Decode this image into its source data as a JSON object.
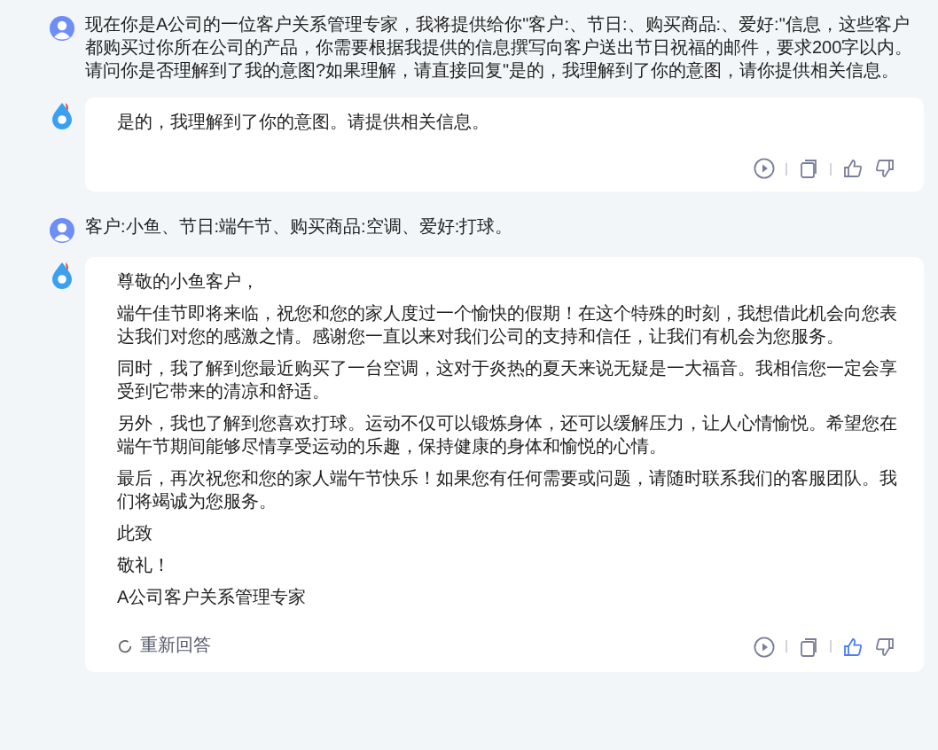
{
  "messages": [
    {
      "kind": "user",
      "text": "现在你是A公司的一位客户关系管理专家，我将提供给你\"客户:、节日:、购买商品:、爱好:\"信息，这些客户都购买过你所在公司的产品，你需要根据我提供的信息撰写向客户送出节日祝福的邮件，要求200字以内。请问你是否理解到了我的意图?如果理解，请直接回复\"是的，我理解到了你的意图，请你提供相关信息。"
    },
    {
      "kind": "bot",
      "paragraphs": [
        "是的，我理解到了你的意图。请提供相关信息。"
      ],
      "liked": false
    },
    {
      "kind": "user",
      "text": "客户:小鱼、节日:端午节、购买商品:空调、爱好:打球。"
    },
    {
      "kind": "bot",
      "paragraphs": [
        "尊敬的小鱼客户，",
        "端午佳节即将来临，祝您和您的家人度过一个愉快的假期！在这个特殊的时刻，我想借此机会向您表达我们对您的感激之情。感谢您一直以来对我们公司的支持和信任，让我们有机会为您服务。",
        "同时，我了解到您最近购买了一台空调，这对于炎热的夏天来说无疑是一大福音。我相信您一定会享受到它带来的清凉和舒适。",
        "另外，我也了解到您喜欢打球。运动不仅可以锻炼身体，还可以缓解压力，让人心情愉悦。希望您在端午节期间能够尽情享受运动的乐趣，保持健康的身体和愉悦的心情。",
        "最后，再次祝您和您的家人端午节快乐！如果您有任何需要或问题，请随时联系我们的客服团队。我们将竭诚为您服务。",
        "此致",
        "敬礼！",
        "A公司客户关系管理专家"
      ],
      "regenerate": "重新回答",
      "liked": true
    }
  ]
}
